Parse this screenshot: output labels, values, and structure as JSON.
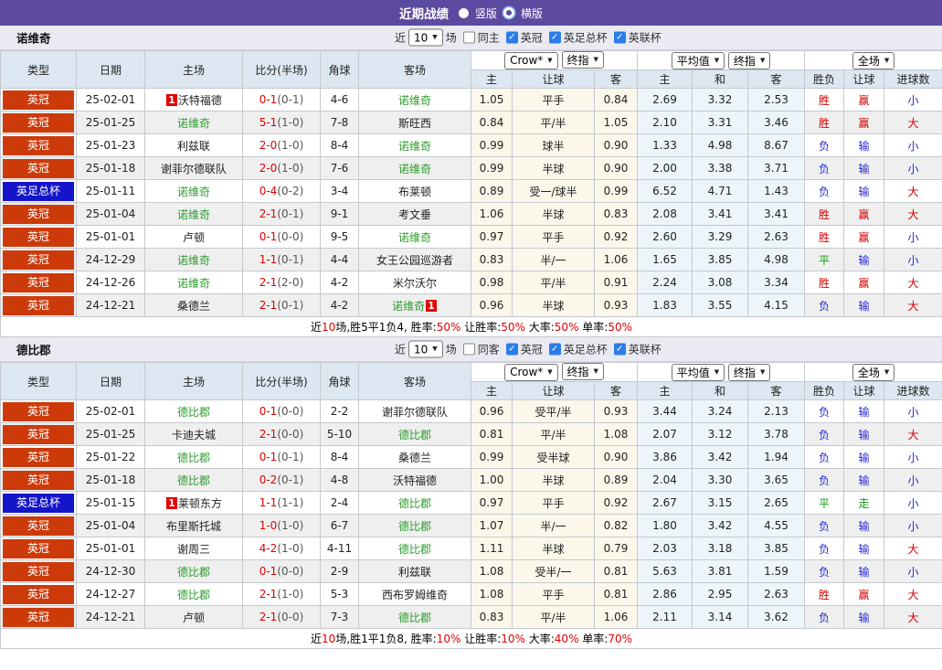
{
  "topbar": {
    "title": "近期战绩",
    "vertical": "竖版",
    "horizontal": "横版"
  },
  "controls": {
    "near": "近",
    "count": "10",
    "games": "场",
    "leagues": [
      "英冠",
      "英足总杯",
      "英联杯"
    ]
  },
  "selects": {
    "company": "Crow*",
    "company_time": "终指",
    "average": "平均值",
    "average_time": "终指",
    "scope": "全场"
  },
  "columns": {
    "type": "类型",
    "date": "日期",
    "home": "主场",
    "score": "比分(半场)",
    "corner": "角球",
    "away": "客场",
    "h_home": "主",
    "h_line": "让球",
    "h_away": "客",
    "a_home": "主",
    "a_draw": "和",
    "a_away": "客",
    "r_wdl": "胜负",
    "r_handicap": "让球",
    "r_goals": "进球数"
  },
  "colors": {
    "accent_purple": "#5b4a9f",
    "league_badge": "#cc3a0a",
    "cup_badge": "#1414c8",
    "team_green": "#2e9b2e",
    "score_red": "#e00000",
    "checkbox_blue": "#2b7ce9",
    "result_map": {
      "胜": "#d50000",
      "赢": "#d50000",
      "大": "#d50000",
      "负": "#2626d8",
      "输": "#2626d8",
      "小": "#2626d8",
      "平": "#109c10",
      "走": "#109c10"
    }
  },
  "sections": [
    {
      "team": "诺维奇",
      "same_venue": "同主",
      "rows": [
        {
          "type": "英冠",
          "cup": false,
          "date": "25-02-01",
          "home": "沃特福德",
          "home_green": false,
          "home_card": "1",
          "score": "0-1",
          "half": "(0-1)",
          "corners": "4-6",
          "away": "诺维奇",
          "away_green": true,
          "away_card": "",
          "handicap": [
            "1.05",
            "平手",
            "0.84"
          ],
          "average": [
            "2.69",
            "3.32",
            "2.53"
          ],
          "results": [
            "胜",
            "赢",
            "小"
          ]
        },
        {
          "type": "英冠",
          "cup": false,
          "date": "25-01-25",
          "home": "诺维奇",
          "home_green": true,
          "home_card": "",
          "score": "5-1",
          "half": "(1-0)",
          "corners": "7-8",
          "away": "斯旺西",
          "away_green": false,
          "away_card": "",
          "handicap": [
            "0.84",
            "平/半",
            "1.05"
          ],
          "average": [
            "2.10",
            "3.31",
            "3.46"
          ],
          "results": [
            "胜",
            "赢",
            "大"
          ]
        },
        {
          "type": "英冠",
          "cup": false,
          "date": "25-01-23",
          "home": "利兹联",
          "home_green": false,
          "home_card": "",
          "score": "2-0",
          "half": "(1-0)",
          "corners": "8-4",
          "away": "诺维奇",
          "away_green": true,
          "away_card": "",
          "handicap": [
            "0.99",
            "球半",
            "0.90"
          ],
          "average": [
            "1.33",
            "4.98",
            "8.67"
          ],
          "results": [
            "负",
            "输",
            "小"
          ]
        },
        {
          "type": "英冠",
          "cup": false,
          "date": "25-01-18",
          "home": "谢菲尔德联队",
          "home_green": false,
          "home_card": "",
          "score": "2-0",
          "half": "(1-0)",
          "corners": "7-6",
          "away": "诺维奇",
          "away_green": true,
          "away_card": "",
          "handicap": [
            "0.99",
            "半球",
            "0.90"
          ],
          "average": [
            "2.00",
            "3.38",
            "3.71"
          ],
          "results": [
            "负",
            "输",
            "小"
          ]
        },
        {
          "type": "英足总杯",
          "cup": true,
          "date": "25-01-11",
          "home": "诺维奇",
          "home_green": true,
          "home_card": "",
          "score": "0-4",
          "half": "(0-2)",
          "corners": "3-4",
          "away": "布莱顿",
          "away_green": false,
          "away_card": "",
          "handicap": [
            "0.89",
            "受一/球半",
            "0.99"
          ],
          "average": [
            "6.52",
            "4.71",
            "1.43"
          ],
          "results": [
            "负",
            "输",
            "大"
          ]
        },
        {
          "type": "英冠",
          "cup": false,
          "date": "25-01-04",
          "home": "诺维奇",
          "home_green": true,
          "home_card": "",
          "score": "2-1",
          "half": "(0-1)",
          "corners": "9-1",
          "away": "考文垂",
          "away_green": false,
          "away_card": "",
          "handicap": [
            "1.06",
            "半球",
            "0.83"
          ],
          "average": [
            "2.08",
            "3.41",
            "3.41"
          ],
          "results": [
            "胜",
            "赢",
            "大"
          ]
        },
        {
          "type": "英冠",
          "cup": false,
          "date": "25-01-01",
          "home": "卢顿",
          "home_green": false,
          "home_card": "",
          "score": "0-1",
          "half": "(0-0)",
          "corners": "9-5",
          "away": "诺维奇",
          "away_green": true,
          "away_card": "",
          "handicap": [
            "0.97",
            "平手",
            "0.92"
          ],
          "average": [
            "2.60",
            "3.29",
            "2.63"
          ],
          "results": [
            "胜",
            "赢",
            "小"
          ]
        },
        {
          "type": "英冠",
          "cup": false,
          "date": "24-12-29",
          "home": "诺维奇",
          "home_green": true,
          "home_card": "",
          "score": "1-1",
          "half": "(0-1)",
          "corners": "4-4",
          "away": "女王公园巡游者",
          "away_green": false,
          "away_card": "",
          "handicap": [
            "0.83",
            "半/一",
            "1.06"
          ],
          "average": [
            "1.65",
            "3.85",
            "4.98"
          ],
          "results": [
            "平",
            "输",
            "小"
          ]
        },
        {
          "type": "英冠",
          "cup": false,
          "date": "24-12-26",
          "home": "诺维奇",
          "home_green": true,
          "home_card": "",
          "score": "2-1",
          "half": "(2-0)",
          "corners": "4-2",
          "away": "米尔沃尔",
          "away_green": false,
          "away_card": "",
          "handicap": [
            "0.98",
            "平/半",
            "0.91"
          ],
          "average": [
            "2.24",
            "3.08",
            "3.34"
          ],
          "results": [
            "胜",
            "赢",
            "大"
          ]
        },
        {
          "type": "英冠",
          "cup": false,
          "date": "24-12-21",
          "home": "桑德兰",
          "home_green": false,
          "home_card": "",
          "score": "2-1",
          "half": "(0-1)",
          "corners": "4-2",
          "away": "诺维奇",
          "away_green": true,
          "away_card": "1",
          "handicap": [
            "0.96",
            "半球",
            "0.93"
          ],
          "average": [
            "1.83",
            "3.55",
            "4.15"
          ],
          "results": [
            "负",
            "输",
            "大"
          ]
        }
      ],
      "summary_parts": [
        [
          "近",
          "k"
        ],
        [
          "10",
          "r"
        ],
        [
          "场,胜5平1负4, 胜率:",
          "k"
        ],
        [
          "50%",
          "r"
        ],
        [
          " 让胜率:",
          "k"
        ],
        [
          "50%",
          "r"
        ],
        [
          " 大率:",
          "k"
        ],
        [
          "50%",
          "r"
        ],
        [
          " 单率:",
          "k"
        ],
        [
          "50%",
          "r"
        ]
      ]
    },
    {
      "team": "德比郡",
      "same_venue": "同客",
      "rows": [
        {
          "type": "英冠",
          "cup": false,
          "date": "25-02-01",
          "home": "德比郡",
          "home_green": true,
          "home_card": "",
          "score": "0-1",
          "half": "(0-0)",
          "corners": "2-2",
          "away": "谢菲尔德联队",
          "away_green": false,
          "away_card": "",
          "handicap": [
            "0.96",
            "受平/半",
            "0.93"
          ],
          "average": [
            "3.44",
            "3.24",
            "2.13"
          ],
          "results": [
            "负",
            "输",
            "小"
          ]
        },
        {
          "type": "英冠",
          "cup": false,
          "date": "25-01-25",
          "home": "卡迪夫城",
          "home_green": false,
          "home_card": "",
          "score": "2-1",
          "half": "(0-0)",
          "corners": "5-10",
          "away": "德比郡",
          "away_green": true,
          "away_card": "",
          "handicap": [
            "0.81",
            "平/半",
            "1.08"
          ],
          "average": [
            "2.07",
            "3.12",
            "3.78"
          ],
          "results": [
            "负",
            "输",
            "大"
          ]
        },
        {
          "type": "英冠",
          "cup": false,
          "date": "25-01-22",
          "home": "德比郡",
          "home_green": true,
          "home_card": "",
          "score": "0-1",
          "half": "(0-1)",
          "corners": "8-4",
          "away": "桑德兰",
          "away_green": false,
          "away_card": "",
          "handicap": [
            "0.99",
            "受半球",
            "0.90"
          ],
          "average": [
            "3.86",
            "3.42",
            "1.94"
          ],
          "results": [
            "负",
            "输",
            "小"
          ]
        },
        {
          "type": "英冠",
          "cup": false,
          "date": "25-01-18",
          "home": "德比郡",
          "home_green": true,
          "home_card": "",
          "score": "0-2",
          "half": "(0-1)",
          "corners": "4-8",
          "away": "沃特福德",
          "away_green": false,
          "away_card": "",
          "handicap": [
            "1.00",
            "半球",
            "0.89"
          ],
          "average": [
            "2.04",
            "3.30",
            "3.65"
          ],
          "results": [
            "负",
            "输",
            "小"
          ]
        },
        {
          "type": "英足总杯",
          "cup": true,
          "date": "25-01-15",
          "home": "莱顿东方",
          "home_green": false,
          "home_card": "1",
          "score": "1-1",
          "half": "(1-1)",
          "corners": "2-4",
          "away": "德比郡",
          "away_green": true,
          "away_card": "",
          "handicap": [
            "0.97",
            "平手",
            "0.92"
          ],
          "average": [
            "2.67",
            "3.15",
            "2.65"
          ],
          "results": [
            "平",
            "走",
            "小"
          ]
        },
        {
          "type": "英冠",
          "cup": false,
          "date": "25-01-04",
          "home": "布里斯托城",
          "home_green": false,
          "home_card": "",
          "score": "1-0",
          "half": "(1-0)",
          "corners": "6-7",
          "away": "德比郡",
          "away_green": true,
          "away_card": "",
          "handicap": [
            "1.07",
            "半/一",
            "0.82"
          ],
          "average": [
            "1.80",
            "3.42",
            "4.55"
          ],
          "results": [
            "负",
            "输",
            "小"
          ]
        },
        {
          "type": "英冠",
          "cup": false,
          "date": "25-01-01",
          "home": "谢周三",
          "home_green": false,
          "home_card": "",
          "score": "4-2",
          "half": "(1-0)",
          "corners": "4-11",
          "away": "德比郡",
          "away_green": true,
          "away_card": "",
          "handicap": [
            "1.11",
            "半球",
            "0.79"
          ],
          "average": [
            "2.03",
            "3.18",
            "3.85"
          ],
          "results": [
            "负",
            "输",
            "大"
          ]
        },
        {
          "type": "英冠",
          "cup": false,
          "date": "24-12-30",
          "home": "德比郡",
          "home_green": true,
          "home_card": "",
          "score": "0-1",
          "half": "(0-0)",
          "corners": "2-9",
          "away": "利兹联",
          "away_green": false,
          "away_card": "",
          "handicap": [
            "1.08",
            "受半/一",
            "0.81"
          ],
          "average": [
            "5.63",
            "3.81",
            "1.59"
          ],
          "results": [
            "负",
            "输",
            "小"
          ]
        },
        {
          "type": "英冠",
          "cup": false,
          "date": "24-12-27",
          "home": "德比郡",
          "home_green": true,
          "home_card": "",
          "score": "2-1",
          "half": "(1-0)",
          "corners": "5-3",
          "away": "西布罗姆维奇",
          "away_green": false,
          "away_card": "",
          "handicap": [
            "1.08",
            "平手",
            "0.81"
          ],
          "average": [
            "2.86",
            "2.95",
            "2.63"
          ],
          "results": [
            "胜",
            "赢",
            "大"
          ]
        },
        {
          "type": "英冠",
          "cup": false,
          "date": "24-12-21",
          "home": "卢顿",
          "home_green": false,
          "home_card": "",
          "score": "2-1",
          "half": "(0-0)",
          "corners": "7-3",
          "away": "德比郡",
          "away_green": true,
          "away_card": "",
          "handicap": [
            "0.83",
            "平/半",
            "1.06"
          ],
          "average": [
            "2.11",
            "3.14",
            "3.62"
          ],
          "results": [
            "负",
            "输",
            "大"
          ]
        }
      ],
      "summary_parts": [
        [
          "近",
          "k"
        ],
        [
          "10",
          "r"
        ],
        [
          "场,胜1平1负8, 胜率:",
          "k"
        ],
        [
          "10%",
          "r"
        ],
        [
          " 让胜率:",
          "k"
        ],
        [
          "10%",
          "r"
        ],
        [
          " 大率:",
          "k"
        ],
        [
          "40%",
          "r"
        ],
        [
          " 单率:",
          "k"
        ],
        [
          "70%",
          "r"
        ]
      ]
    }
  ]
}
